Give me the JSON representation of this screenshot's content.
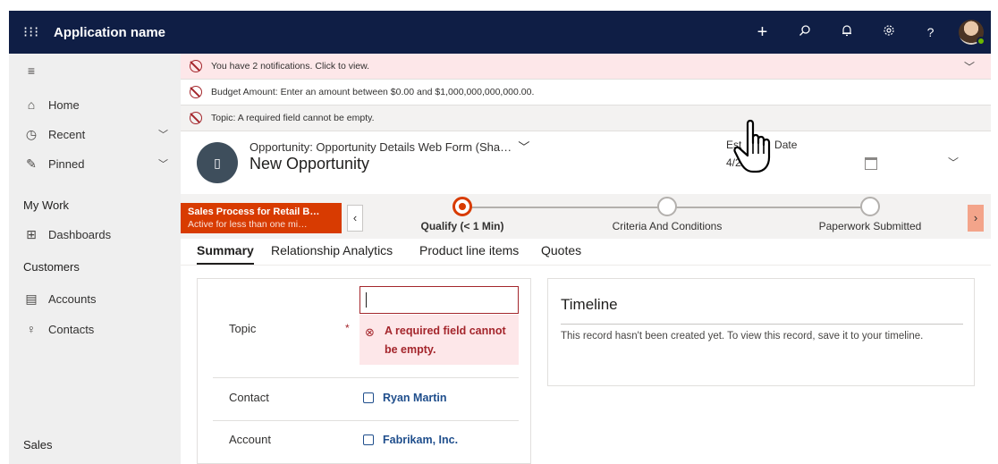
{
  "topbar": {
    "waffle_icon": "waffle-icon",
    "app_name": "Application name",
    "actions": [
      "plus-icon",
      "search-icon",
      "bell-icon",
      "gear-icon",
      "help-icon"
    ],
    "bg_color": "#0f1e45"
  },
  "sidebar": {
    "menu_icon": "hamburger-icon",
    "items_top": [
      {
        "label": "Home",
        "icon": "home-icon"
      },
      {
        "label": "Recent",
        "icon": "clock-icon"
      },
      {
        "label": "Pinned",
        "icon": "pin-icon"
      }
    ],
    "section_mywork": "My Work",
    "dashboards": "Dashboards",
    "section_customers": "Customers",
    "accounts": "Accounts",
    "contacts": "Contacts",
    "section_sales": "Sales"
  },
  "notifications": [
    "You have 2 notifications. Click to view.",
    "Budget Amount: Enter an amount between $0.00 and $1,000,000,000,000.00.",
    "Topic: A required field cannot be empty."
  ],
  "header": {
    "form_selector": "Opportunity: Opportunity Details Web Form (Sha…",
    "title": "New Opportunity",
    "est_label_part1": "Est",
    "est_label_part2": "Date",
    "est_value": "4/2/"
  },
  "bpf": {
    "process_name": "Sales Process for Retail B…",
    "process_status": "Active for less than one mi…",
    "stages": [
      "Qualify  (< 1 Min)",
      "Criteria And Conditions",
      "Paperwork Submitted"
    ],
    "accent": "#d83b01"
  },
  "tabs": [
    "Summary",
    "Relationship Analytics",
    "Product line items",
    "Quotes"
  ],
  "form": {
    "topic_label": "Topic",
    "required_mark": "*",
    "topic_value": "",
    "error_line1": "A required field cannot",
    "error_line2": "be empty.",
    "contact_label": "Contact",
    "contact_value": "Ryan Martin",
    "account_label": "Account",
    "account_value": "Fabrikam, Inc."
  },
  "timeline": {
    "title": "Timeline",
    "text": "This record hasn't been created yet.  To view this record, save it to your timeline."
  }
}
